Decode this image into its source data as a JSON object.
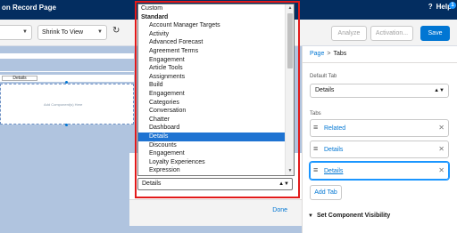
{
  "header": {
    "title": "on Record Page",
    "help_label": "Help",
    "help_icon": "?",
    "help_badge": "1"
  },
  "toolbar": {
    "device_select": "",
    "view_select": "Shrink To View",
    "analyze_label": "Analyze",
    "activation_label": "Activation...",
    "save_label": "Save"
  },
  "canvas": {
    "tab_label": "Details",
    "add_component_text": "Add Component(s) Here"
  },
  "dropdown": {
    "top_option": "Custom",
    "group_label": "Standard",
    "options": [
      "Account Manager Targets",
      "Activity",
      "Advanced Forecast",
      "Agreement Terms",
      "Engagement",
      "Article Tools",
      "Assignments",
      "Build",
      "Engagement",
      "Categories",
      "Conversation",
      "Chatter",
      "Dashboard",
      "Details",
      "Discounts",
      "Engagement",
      "Loyalty Experiences",
      "Expression"
    ],
    "selected_index": 13
  },
  "modal": {
    "select_value": "Details",
    "done_label": "Done"
  },
  "panel": {
    "breadcrumb": [
      "Page",
      "Tabs"
    ],
    "default_tab_label": "Default Tab",
    "default_tab_value": "Details",
    "tabs_label": "Tabs",
    "tabs": [
      "Related",
      "Details",
      "Details"
    ],
    "add_tab_label": "Add Tab",
    "visibility_label": "Set Component Visibility"
  },
  "colors": {
    "header_bg": "#032d60",
    "accent": "#0176d3",
    "highlight": "#e21a1a",
    "selected_option": "#1e73d2"
  }
}
